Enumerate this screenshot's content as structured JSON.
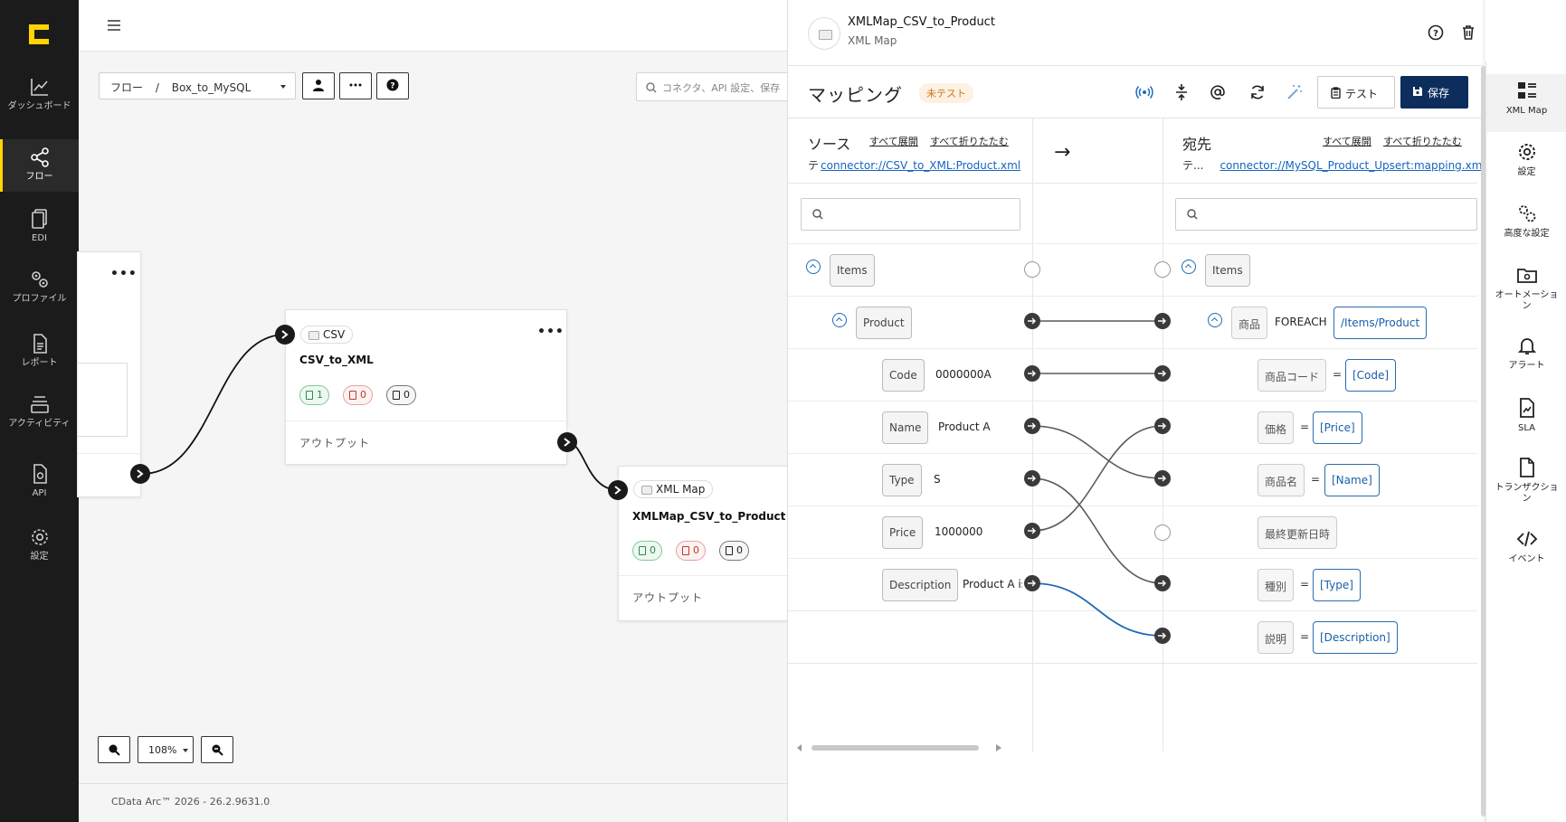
{
  "nav": {
    "items": [
      {
        "label": "ダッシュボード",
        "icon": "chart-line-icon"
      },
      {
        "label": "フロー",
        "icon": "flow-share-icon"
      },
      {
        "label": "EDI",
        "icon": "edi-document-icon"
      },
      {
        "label": "プロファイル",
        "icon": "gears-icon"
      },
      {
        "label": "レポート",
        "icon": "report-icon"
      },
      {
        "label": "アクティビティ",
        "icon": "layers-icon"
      },
      {
        "label": "API",
        "icon": "api-file-icon"
      },
      {
        "label": "設定",
        "icon": "gear-icon"
      }
    ]
  },
  "canvas": {
    "breadcrumb": {
      "root": "フロー",
      "sep": "/",
      "current": "Box_to_MySQL"
    },
    "search_placeholder": "コネクタ、API 設定、保存",
    "zoom": "108%",
    "footer": "CData Arc™ 2026 - 26.2.9631.0",
    "nodes": [
      {
        "tag": "CSV",
        "title": "CSV_to_XML",
        "pills": [
          "1",
          "0",
          "0"
        ],
        "output": "アウトプット"
      },
      {
        "tag": "XML Map",
        "title": "XMLMap_CSV_to_Product",
        "pills": [
          "0",
          "0",
          "0"
        ],
        "output": "アウトプット"
      }
    ]
  },
  "panel": {
    "title": "XMLMap_CSV_to_Product",
    "subtitle": "XML Map",
    "mapping_title": "マッピング",
    "status_badge": "未テスト",
    "test_label": "テスト",
    "save_label": "保存",
    "source": {
      "label": "ソース",
      "expand_all": "すべて展開",
      "collapse_all": "すべて折りたたむ",
      "prefix": "テ",
      "path": "connector://CSV_to_XML:Product.xml"
    },
    "dest": {
      "label": "宛先",
      "expand_all": "すべて展開",
      "collapse_all": "すべて折りたたむ",
      "prefix": "テ...",
      "path": "connector://MySQL_Product_Upsert:mapping.xml"
    },
    "arrow": "→",
    "source_rows": [
      {
        "name": "Items",
        "value": ""
      },
      {
        "name": "Product",
        "value": ""
      },
      {
        "name": "Code",
        "value": "0000000A"
      },
      {
        "name": "Name",
        "value": "Product A"
      },
      {
        "name": "Type",
        "value": "S"
      },
      {
        "name": "Price",
        "value": "1000000"
      },
      {
        "name": "Description",
        "value": "Product A is"
      }
    ],
    "dest_rows": [
      {
        "name": "Items"
      },
      {
        "name": "商品",
        "keyword": "FOREACH",
        "expr": "/Items/Product"
      },
      {
        "name": "商品コード",
        "eq": "=",
        "expr": "[Code]"
      },
      {
        "name": "価格",
        "eq": "=",
        "expr": "[Price]"
      },
      {
        "name": "商品名",
        "eq": "=",
        "expr": "[Name]"
      },
      {
        "name": "最終更新日時"
      },
      {
        "name": "種別",
        "eq": "=",
        "expr": "[Type]"
      },
      {
        "name": "説明",
        "eq": "=",
        "expr": "[Description]"
      }
    ],
    "mappings": [
      {
        "from": "Product",
        "to": "商品"
      },
      {
        "from": "Code",
        "to": "商品コード"
      },
      {
        "from": "Name",
        "to": "商品名"
      },
      {
        "from": "Type",
        "to": "種別"
      },
      {
        "from": "Price",
        "to": "価格"
      },
      {
        "from": "Description",
        "to": "説明",
        "highlight": true
      }
    ]
  },
  "rail": {
    "items": [
      {
        "label": "XML Map",
        "icon": "xml-map-icon"
      },
      {
        "label": "設定",
        "icon": "gear-icon"
      },
      {
        "label": "高度な設定",
        "icon": "advanced-gears-icon"
      },
      {
        "label": "オートメーション",
        "icon": "automation-folder-icon"
      },
      {
        "label": "アラート",
        "icon": "bell-icon"
      },
      {
        "label": "SLA",
        "icon": "sla-document-icon"
      },
      {
        "label": "トランザクション",
        "icon": "transaction-document-icon"
      },
      {
        "label": "イベント",
        "icon": "code-icon"
      }
    ]
  },
  "colors": {
    "nav_bg": "#1b1b1b",
    "accent": "#ffd400",
    "save_bg": "#0d2e5c",
    "link": "#1565c0",
    "highlight_line": "#1e6ab5",
    "badge_text": "#c57a17"
  }
}
